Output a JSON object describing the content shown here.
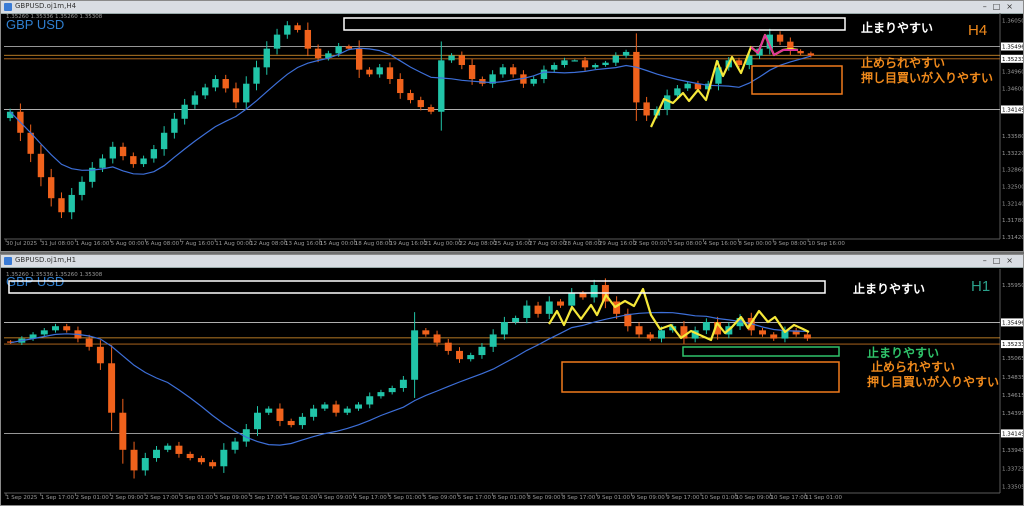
{
  "windows": [
    {
      "id": "w4",
      "title": "GBPUSD.oj1m,H4",
      "symbol": "GBP USD",
      "timeframe": "H4",
      "header_text": "1.35260 1.35336 1.35260 1.35308",
      "annotations": {
        "top_label": "止まりやすい",
        "side_label_1": "止められやすい",
        "side_label_2": "押し目買いが入りやすい"
      }
    },
    {
      "id": "w1",
      "title": "GBPUSD.oj1m,H1",
      "symbol": "GBP USD",
      "timeframe": "H1",
      "header_text": "1.35260 1.35336 1.35260 1.35308",
      "annotations": {
        "top_label": "止まりやすい",
        "side_label_0": "止まりやすい",
        "side_label_1": "止められやすい",
        "side_label_2": "押し目買いが入りやすい"
      }
    }
  ],
  "colors": {
    "bull": "#21c4a8",
    "bear": "#f0621c",
    "ma": "#3d6fd8",
    "zigzag": "#f5e83a",
    "zigzag_peak": "#e0309a",
    "hline": "#c8c8c8",
    "box_white": "#ffffff",
    "box_orange": "#f07a1c",
    "box_green": "#2fc36a"
  },
  "chart_data": [
    {
      "type": "candlestick",
      "instrument": "GBPUSD",
      "timeframe": "H4",
      "xticks": [
        "30 Jul 2025",
        "31 Jul 08:00",
        "1 Aug 16:00",
        "5 Aug 00:00",
        "6 Aug 08:00",
        "7 Aug 16:00",
        "11 Aug 00:00",
        "12 Aug 08:00",
        "13 Aug 16:00",
        "15 Aug 00:00",
        "18 Aug 08:00",
        "19 Aug 16:00",
        "21 Aug 00:00",
        "22 Aug 08:00",
        "25 Aug 16:00",
        "27 Aug 00:00",
        "28 Aug 08:00",
        "29 Aug 16:00",
        "2 Sep 00:00",
        "3 Sep 08:00",
        "4 Sep 16:00",
        "8 Sep 00:00",
        "9 Sep 08:00",
        "10 Sep 16:00"
      ],
      "yticks": [
        "1.36050",
        "1.35496",
        "1.35233",
        "1.34960",
        "1.34600",
        "1.34149",
        "1.33580",
        "1.33220",
        "1.32860",
        "1.32500",
        "1.32140",
        "1.31780",
        "1.31420"
      ],
      "ylim": [
        1.3142,
        1.3617
      ],
      "levels": [
        1.35496,
        1.35308,
        1.35233,
        1.34149
      ],
      "path": [
        1.341,
        1.3365,
        1.332,
        1.327,
        1.3225,
        1.3195,
        1.3232,
        1.326,
        1.329,
        1.331,
        1.3335,
        1.3315,
        1.3298,
        1.331,
        1.333,
        1.3365,
        1.3395,
        1.3425,
        1.3445,
        1.3462,
        1.348,
        1.346,
        1.343,
        1.347,
        1.3505,
        1.3545,
        1.3575,
        1.3595,
        1.3585,
        1.3545,
        1.3525,
        1.3535,
        1.355,
        1.3545,
        1.35,
        1.349,
        1.3505,
        1.348,
        1.345,
        1.3435,
        1.342,
        1.341,
        1.352,
        1.353,
        1.351,
        1.348,
        1.347,
        1.349,
        1.3505,
        1.349,
        1.347,
        1.348,
        1.35,
        1.351,
        1.352,
        1.352,
        1.3505,
        1.351,
        1.3515,
        1.353,
        1.3538,
        1.343,
        1.3402,
        1.3415,
        1.3445,
        1.346,
        1.347,
        1.3458,
        1.347,
        1.3505,
        1.352,
        1.351,
        1.353,
        1.3545,
        1.3575,
        1.356,
        1.354,
        1.3535,
        1.353
      ]
    },
    {
      "type": "candlestick",
      "instrument": "GBPUSD",
      "timeframe": "H1",
      "xticks": [
        "1 Sep 2025",
        "1 Sep 17:00",
        "2 Sep 01:00",
        "2 Sep 09:00",
        "2 Sep 17:00",
        "3 Sep 01:00",
        "3 Sep 09:00",
        "3 Sep 17:00",
        "4 Sep 01:00",
        "4 Sep 09:00",
        "4 Sep 17:00",
        "5 Sep 01:00",
        "5 Sep 09:00",
        "5 Sep 17:00",
        "8 Sep 01:00",
        "8 Sep 09:00",
        "8 Sep 17:00",
        "9 Sep 01:00",
        "9 Sep 09:00",
        "9 Sep 17:00",
        "10 Sep 01:00",
        "10 Sep 09:00",
        "10 Sep 17:00",
        "11 Sep 01:00"
      ],
      "yticks": [
        "1.35950",
        "1.35496",
        "1.35233",
        "1.35065",
        "1.34835",
        "1.34615",
        "1.34395",
        "1.34149",
        "1.33945",
        "1.33725",
        "1.33505"
      ],
      "ylim": [
        1.3345,
        1.3612
      ],
      "levels": [
        1.35496,
        1.35308,
        1.35233,
        1.34149
      ],
      "path": [
        1.3525,
        1.353,
        1.3535,
        1.354,
        1.3545,
        1.354,
        1.353,
        1.352,
        1.35,
        1.344,
        1.3395,
        1.337,
        1.3385,
        1.3395,
        1.34,
        1.339,
        1.3385,
        1.338,
        1.3375,
        1.3395,
        1.3405,
        1.342,
        1.344,
        1.3445,
        1.343,
        1.3425,
        1.3435,
        1.3445,
        1.345,
        1.344,
        1.3445,
        1.345,
        1.346,
        1.3465,
        1.347,
        1.348,
        1.354,
        1.3535,
        1.3525,
        1.3515,
        1.3505,
        1.351,
        1.352,
        1.3535,
        1.355,
        1.3555,
        1.357,
        1.356,
        1.3575,
        1.357,
        1.3585,
        1.358,
        1.3595,
        1.3575,
        1.356,
        1.3545,
        1.3535,
        1.353,
        1.354,
        1.3545,
        1.353,
        1.354,
        1.355,
        1.3535,
        1.3545,
        1.3555,
        1.354,
        1.3535,
        1.353,
        1.354,
        1.3535,
        1.353
      ]
    }
  ]
}
